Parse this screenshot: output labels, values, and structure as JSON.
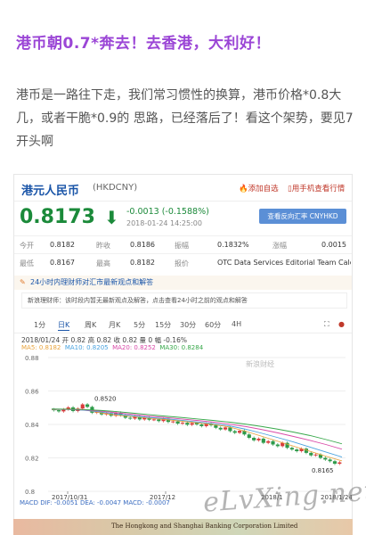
{
  "article": {
    "title": "港币朝0.7*奔去！去香港，大利好！",
    "paragraph": "港币是一路往下走，我们常习惯性的换算，港币价格*0.8大几，或者干脆*0.9的 思路，已经落后了！看这个架势，要见7开头啊"
  },
  "quote": {
    "name": "港元人民币",
    "code": "(HKDCNY)",
    "add_watch": "添加自选",
    "mobile_view": "用手机查看行情",
    "price": "0.8173",
    "change": "-0.0013 (-0.1588%)",
    "time": "2018-01-24 14:25:00",
    "compare_button": "查看反向汇率 CNYHKD",
    "stats": {
      "row1": [
        {
          "label": "今开",
          "value": "0.8182"
        },
        {
          "label": "昨收",
          "value": "0.8186"
        },
        {
          "label": "振幅",
          "value": "0.1832%"
        },
        {
          "label": "涨幅",
          "value": "0.0015"
        }
      ],
      "row2": [
        {
          "label": "最低",
          "value": "0.8167"
        },
        {
          "label": "最高",
          "value": "0.8182"
        },
        {
          "label": "报价",
          "value": "OTC Data Services Editorial Team Calc..."
        }
      ]
    },
    "news_bar": "24小时内理财师对汇市最新观点和解答",
    "news_box": "新浪理财师：该时段内暂无最新观点及解答，点击查看24小时之前的观点和解答"
  },
  "chart": {
    "tabs": [
      "1分",
      "日K",
      "周K",
      "月K",
      "5分",
      "15分",
      "30分",
      "60分",
      "4H"
    ],
    "active_tab": "日K",
    "ohlc_text": "2018/01/24 开 0.82 高 0.82 收 0.82 量 0 幅 -0.16%",
    "ma_labels": [
      {
        "text": "MA5: 0.8182",
        "color": "#e8a33c"
      },
      {
        "text": "MA10: 0.8205",
        "color": "#4aa3df"
      },
      {
        "text": "MA20: 0.8252",
        "color": "#d94aa8"
      },
      {
        "text": "MA30: 0.8284",
        "color": "#37a84a"
      }
    ],
    "macd_text": "MACD  DIF: -0.0051   DEA: -0.0047   MACD: -0.0007",
    "watermark_sina": "新浪财经",
    "chart_data": {
      "type": "candlestick",
      "y_ticks": [
        "0.88",
        "0.86",
        "0.84",
        "0.82",
        "0.8"
      ],
      "ylim": [
        0.8,
        0.88
      ],
      "x_ticks": [
        "2017/10/31",
        "2017/12",
        "2018/1",
        "2018/1/24"
      ],
      "annotations": [
        "0.8520",
        "0.8165"
      ],
      "close_series": [
        0.8485,
        0.8478,
        0.849,
        0.8502,
        0.848,
        0.8495,
        0.852,
        0.8505,
        0.847,
        0.8475,
        0.846,
        0.8468,
        0.8452,
        0.847,
        0.8455,
        0.844,
        0.8435,
        0.8448,
        0.843,
        0.8442,
        0.8428,
        0.843,
        0.842,
        0.8435,
        0.8415,
        0.8418,
        0.8405,
        0.841,
        0.8398,
        0.8408,
        0.84,
        0.839,
        0.8405,
        0.8395,
        0.838,
        0.837,
        0.8382,
        0.836,
        0.835,
        0.8362,
        0.834,
        0.832,
        0.8305,
        0.8315,
        0.829,
        0.83,
        0.828,
        0.827,
        0.829,
        0.826,
        0.825,
        0.824,
        0.8255,
        0.823,
        0.8215,
        0.822,
        0.82,
        0.819,
        0.818,
        0.8165,
        0.8173
      ],
      "ma_series": [
        {
          "name": "MA5",
          "color": "#e8a33c",
          "values": [
            0.8488,
            0.8492,
            0.8488,
            0.847,
            0.8455,
            0.8448,
            0.8438,
            0.843,
            0.842,
            0.841,
            0.84,
            0.8385,
            0.836,
            0.833,
            0.83,
            0.827,
            0.824,
            0.821,
            0.8182
          ]
        },
        {
          "name": "MA10",
          "color": "#4aa3df",
          "values": [
            0.849,
            0.849,
            0.8485,
            0.8475,
            0.8462,
            0.8452,
            0.8442,
            0.8435,
            0.8425,
            0.8415,
            0.8405,
            0.8392,
            0.8372,
            0.8348,
            0.8322,
            0.8295,
            0.8265,
            0.8235,
            0.8205
          ]
        },
        {
          "name": "MA20",
          "color": "#d94aa8",
          "values": [
            0.8492,
            0.849,
            0.8487,
            0.848,
            0.847,
            0.846,
            0.845,
            0.8442,
            0.8433,
            0.8424,
            0.8414,
            0.8402,
            0.8388,
            0.837,
            0.835,
            0.8328,
            0.8305,
            0.828,
            0.8252
          ]
        },
        {
          "name": "MA30",
          "color": "#37a84a",
          "values": [
            0.8492,
            0.8491,
            0.8489,
            0.8484,
            0.8477,
            0.8468,
            0.8459,
            0.845,
            0.8442,
            0.8433,
            0.8424,
            0.8414,
            0.8402,
            0.8388,
            0.8372,
            0.8354,
            0.8334,
            0.831,
            0.8284
          ]
        }
      ]
    }
  },
  "footer": {
    "watermark": "eLvXing.net",
    "banknote_text": "The Hongkong and Shanghai Banking Corporation Limited"
  }
}
